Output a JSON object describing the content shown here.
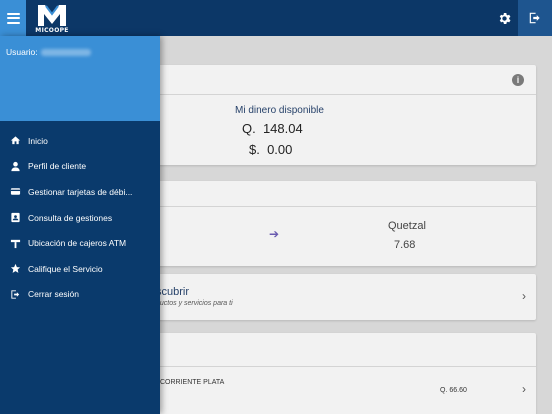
{
  "header": {
    "logo_text": "MICOOPE",
    "menu_icon": "hamburger-icon",
    "settings_icon": "gear-icon",
    "logout_icon": "logout-icon"
  },
  "drawer": {
    "user_label": "Usuario:",
    "items": [
      {
        "label": "Inicio",
        "icon": "home-icon"
      },
      {
        "label": "Perfil de cliente",
        "icon": "person-icon"
      },
      {
        "label": "Gestionar tarjetas de débi...",
        "icon": "card-icon"
      },
      {
        "label": "Consulta de gestiones",
        "icon": "contact-card-icon"
      },
      {
        "label": "Ubicación de cajeros ATM",
        "icon": "atm-location-icon"
      },
      {
        "label": "Califique el Servicio",
        "icon": "star-icon"
      },
      {
        "label": "Cerrar sesión",
        "icon": "logout-icon"
      }
    ]
  },
  "balance_card": {
    "title": "Mi dinero disponible",
    "quetzal": "Q.  148.04",
    "dollar": "$.  0.00"
  },
  "exchange_card": {
    "currency": "Quetzal",
    "value": "7.68"
  },
  "discover_card": {
    "title": "scubrir",
    "subtitle": "ductos y servicios para ti"
  },
  "accounts_card": {
    "account_name": "CORRIENTE PLATA",
    "account_balance": "Q. 66.60"
  },
  "colors": {
    "topbar": "#0c3767",
    "accent": "#3a8fd6",
    "drawer": "#0a3a6c"
  }
}
